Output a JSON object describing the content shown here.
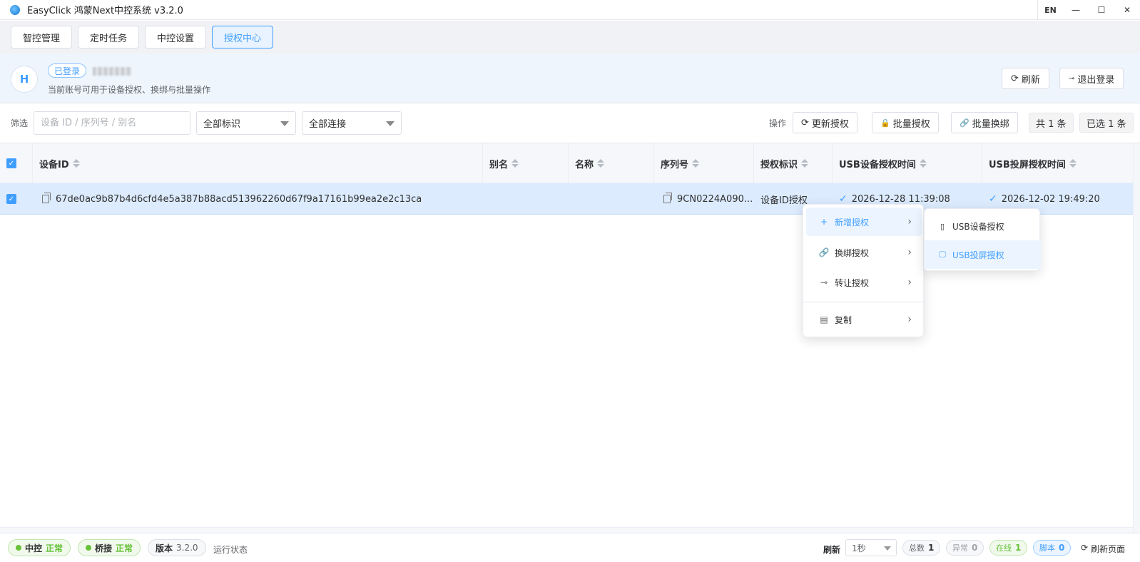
{
  "window": {
    "title": "EasyClick 鸿蒙Next中控系统 v3.2.0",
    "lang": "EN",
    "minimize": "—",
    "maximize": "☐",
    "close": "✕"
  },
  "tabs": [
    {
      "label": "智控管理"
    },
    {
      "label": "定时任务"
    },
    {
      "label": "中控设置"
    },
    {
      "label": "授权中心",
      "active": true
    }
  ],
  "account": {
    "avatar": "H",
    "status": "已登录",
    "description": "当前账号可用于设备授权、换绑与批量操作",
    "refresh_label": "刷新",
    "logout_label": "退出登录"
  },
  "filter": {
    "label": "筛选",
    "search_placeholder": "设备 ID / 序列号 / 别名",
    "tag_select": "全部标识",
    "conn_select": "全部连接",
    "op_label": "操作",
    "update_label": "更新授权",
    "batch_auth_label": "批量授权",
    "batch_rebind_label": "批量换绑",
    "total": "共 1 条",
    "selected": "已选 1 条"
  },
  "table": {
    "columns": [
      "设备ID",
      "别名",
      "名称",
      "序列号",
      "授权标识",
      "USB设备授权时间",
      "USB投屏授权时间"
    ],
    "rows": [
      {
        "device_id": "67de0ac9b87b4d6cfd4e5a387b88acd513962260d67f9a17161b99ea2e2c13ca",
        "alias": "",
        "name": "",
        "serial": "9CN0224A090...",
        "tag": "设备ID授权",
        "usb_device_time": "2026-12-28 11:39:08",
        "usb_cast_time": "2026-12-02 19:49:20"
      }
    ]
  },
  "context_menu": {
    "items": [
      {
        "label": "新增授权",
        "icon": "+"
      },
      {
        "label": "换绑授权",
        "icon": "🔗"
      },
      {
        "label": "转让授权",
        "icon": "⊸"
      },
      {
        "label": "复制",
        "icon": "▤"
      }
    ],
    "submenu": [
      {
        "label": "USB设备授权",
        "icon": "▯"
      },
      {
        "label": "USB投屏授权",
        "icon": "🖵"
      }
    ]
  },
  "status": {
    "zk_label": "中控",
    "zk_value": "正常",
    "qj_label": "桥接",
    "qj_value": "正常",
    "version_label": "版本",
    "version_value": "3.2.0",
    "run_state": "运行状态",
    "refresh_label": "刷新",
    "refresh_interval": "1秒",
    "total_label": "总数",
    "total_value": "1",
    "abnormal_label": "异常",
    "abnormal_value": "0",
    "online_label": "在线",
    "online_value": "1",
    "script_label": "脚本",
    "script_value": "0",
    "refresh_page_label": "刷新页面"
  },
  "colors": {
    "primary": "#409eff",
    "success": "#67c23a",
    "row_selected": "#dcebfd"
  }
}
